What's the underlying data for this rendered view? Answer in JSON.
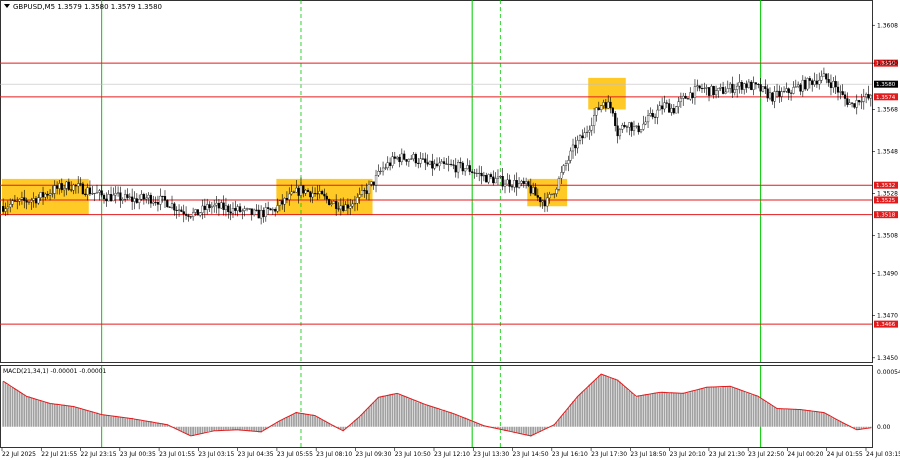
{
  "header": {
    "title": "GBPUSD,M5  1.3579 1.3580 1.3579 1.3580",
    "macd_label": "MACD(21,34,1) -0.00001 -0.00001"
  },
  "colors": {
    "candle": "#000000",
    "level_line": "#e31a1c",
    "price_marker": "#000000",
    "day_separator": "#00c800",
    "highlight_box": "#ffc000",
    "macd_hist": "#a0a0a0",
    "macd_signal": "#e31a1c"
  },
  "chart_data": [
    {
      "type": "candlestick",
      "symbol": "GBPUSD",
      "timeframe": "M5",
      "ylim": [
        1.3448,
        1.362
      ],
      "yticks": [
        "1.3608",
        "1.3590",
        "1.3568",
        "1.3548",
        "1.3528",
        "1.3508",
        "1.3490",
        "1.3470",
        "1.3450"
      ],
      "xticks": [
        "22 Jul 2025",
        "22 Jul 21:55",
        "22 Jul 23:15",
        "23 Jul 00:35",
        "23 Jul 01:55",
        "23 Jul 03:15",
        "23 Jul 04:35",
        "23 Jul 05:55",
        "23 Jul 08:10",
        "23 Jul 09:30",
        "23 Jul 10:50",
        "23 Jul 12:10",
        "23 Jul 13:30",
        "23 Jul 14:50",
        "23 Jul 16:10",
        "23 Jul 17:30",
        "23 Jul 18:50",
        "23 Jul 20:10",
        "23 Jul 21:30",
        "23 Jul 22:50",
        "24 Jul 00:20",
        "24 Jul 01:55",
        "24 Jul 03:15"
      ],
      "price_path": [
        [
          0,
          1.3522
        ],
        [
          8,
          1.3524
        ],
        [
          15,
          1.3526
        ],
        [
          22,
          1.353
        ],
        [
          28,
          1.3532
        ],
        [
          35,
          1.353
        ],
        [
          42,
          1.3527
        ],
        [
          50,
          1.3526
        ],
        [
          56,
          1.3525
        ],
        [
          62,
          1.3526
        ],
        [
          70,
          1.3524
        ],
        [
          76,
          1.352
        ],
        [
          82,
          1.3518
        ],
        [
          88,
          1.3522
        ],
        [
          95,
          1.3521
        ],
        [
          100,
          1.352
        ],
        [
          108,
          1.3518
        ],
        [
          115,
          1.352
        ],
        [
          122,
          1.3526
        ],
        [
          127,
          1.353
        ],
        [
          133,
          1.3528
        ],
        [
          140,
          1.3524
        ],
        [
          146,
          1.3522
        ],
        [
          152,
          1.3526
        ],
        [
          157,
          1.3532
        ],
        [
          162,
          1.354
        ],
        [
          168,
          1.3545
        ],
        [
          175,
          1.3545
        ],
        [
          182,
          1.3541
        ],
        [
          190,
          1.3541
        ],
        [
          198,
          1.354
        ],
        [
          205,
          1.3536
        ],
        [
          212,
          1.3534
        ],
        [
          218,
          1.3533
        ],
        [
          224,
          1.3531
        ],
        [
          228,
          1.3526
        ],
        [
          232,
          1.3524
        ],
        [
          236,
          1.3532
        ],
        [
          240,
          1.3542
        ],
        [
          244,
          1.3551
        ],
        [
          248,
          1.3556
        ],
        [
          252,
          1.3565
        ],
        [
          256,
          1.3572
        ],
        [
          260,
          1.3568
        ],
        [
          262,
          1.3557
        ],
        [
          266,
          1.3562
        ],
        [
          270,
          1.3558
        ],
        [
          274,
          1.3562
        ],
        [
          278,
          1.3566
        ],
        [
          282,
          1.357
        ],
        [
          286,
          1.3568
        ],
        [
          292,
          1.3575
        ],
        [
          298,
          1.3578
        ],
        [
          304,
          1.3576
        ],
        [
          310,
          1.3578
        ],
        [
          316,
          1.358
        ],
        [
          322,
          1.3578
        ],
        [
          328,
          1.3574
        ],
        [
          334,
          1.3576
        ],
        [
          340,
          1.3579
        ],
        [
          346,
          1.3582
        ],
        [
          350,
          1.3583
        ],
        [
          354,
          1.358
        ],
        [
          358,
          1.3574
        ],
        [
          362,
          1.357
        ],
        [
          366,
          1.3574
        ],
        [
          370,
          1.3573
        ]
      ],
      "levels": [
        {
          "value": 1.359,
          "label": "1.3590"
        },
        {
          "value": 1.3574,
          "label": "1.3574"
        },
        {
          "value": 1.3532,
          "label": "1.3532"
        },
        {
          "value": 1.3525,
          "label": "1.3525"
        },
        {
          "value": 1.3518,
          "label": "1.3518"
        },
        {
          "value": 1.3466,
          "label": "1.3466"
        }
      ],
      "current_price": {
        "value": 1.358,
        "label": "1.3580"
      },
      "day_separators_bar_index": [
        42,
        200,
        323
      ],
      "session_separators_bar_index": [
        127,
        212
      ],
      "highlight_zones": [
        {
          "bar_from": 0,
          "bar_to": 36,
          "price_low": 1.3518,
          "price_high": 1.3535
        },
        {
          "bar_from": 117,
          "bar_to": 157,
          "price_low": 1.3518,
          "price_high": 1.3535
        },
        {
          "bar_from": 224,
          "bar_to": 240,
          "price_low": 1.3522,
          "price_high": 1.3535
        },
        {
          "bar_from": 250,
          "bar_to": 265,
          "price_low": 1.3568,
          "price_high": 1.3583
        }
      ]
    },
    {
      "type": "bar",
      "name": "MACD(21,34,1)",
      "ylim": [
        -0.0002,
        0.0006
      ],
      "yticks": [
        "0.00054",
        "0.00"
      ],
      "macd_path": [
        [
          0,
          0.00045
        ],
        [
          10,
          0.0003
        ],
        [
          20,
          0.00023
        ],
        [
          30,
          0.0002
        ],
        [
          42,
          0.00012
        ],
        [
          55,
          8e-05
        ],
        [
          70,
          2e-05
        ],
        [
          80,
          -9e-05
        ],
        [
          90,
          -4e-05
        ],
        [
          100,
          -3e-05
        ],
        [
          110,
          -5e-05
        ],
        [
          118,
          6e-05
        ],
        [
          125,
          0.00014
        ],
        [
          133,
          0.00011
        ],
        [
          140,
          2e-05
        ],
        [
          145,
          -4e-05
        ],
        [
          152,
          0.0001
        ],
        [
          160,
          0.00029
        ],
        [
          168,
          0.00033
        ],
        [
          180,
          0.00022
        ],
        [
          192,
          0.00013
        ],
        [
          205,
          1e-05
        ],
        [
          215,
          -4e-05
        ],
        [
          225,
          -9e-05
        ],
        [
          235,
          2e-05
        ],
        [
          245,
          0.0003
        ],
        [
          255,
          0.00052
        ],
        [
          262,
          0.00046
        ],
        [
          270,
          0.0003
        ],
        [
          280,
          0.00034
        ],
        [
          290,
          0.00033
        ],
        [
          300,
          0.00039
        ],
        [
          310,
          0.0004
        ],
        [
          322,
          0.0003
        ],
        [
          330,
          0.00018
        ],
        [
          340,
          0.00017
        ],
        [
          350,
          0.00014
        ],
        [
          358,
          4e-05
        ],
        [
          364,
          -3e-05
        ],
        [
          370,
          -1e-05
        ]
      ]
    }
  ]
}
